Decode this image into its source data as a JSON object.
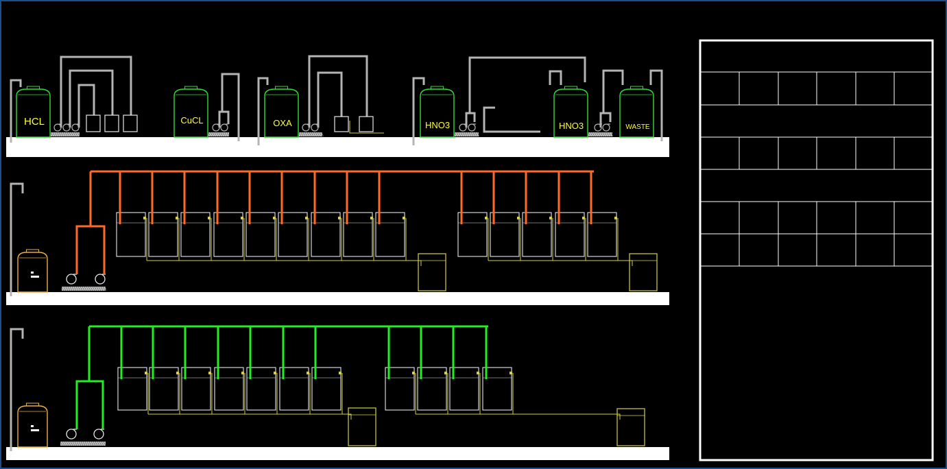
{
  "tanks": [
    {
      "label": "HCL"
    },
    {
      "label": "CuCL"
    },
    {
      "label": "OXA"
    },
    {
      "label": "HNO3"
    },
    {
      "label": "HNO3"
    },
    {
      "label": "WASTE"
    }
  ],
  "colors": {
    "background": "#000000",
    "frame": "#1a4f8a",
    "floor": "#ffffff",
    "pipe_gray": "#b4b4b4",
    "tank_green": "#33dd33",
    "label_yellow": "#ffff33",
    "line2_pipe": "#ff6a26",
    "line3_pipe": "#22ee22",
    "drain_line": "#d8d040",
    "bath_outline": "#e8e8e8",
    "tank_orange": "#e8b040"
  },
  "icons": [
    "pump-icon",
    "storage-tank-icon",
    "bath-tank-icon",
    "waste-bin-icon"
  ]
}
